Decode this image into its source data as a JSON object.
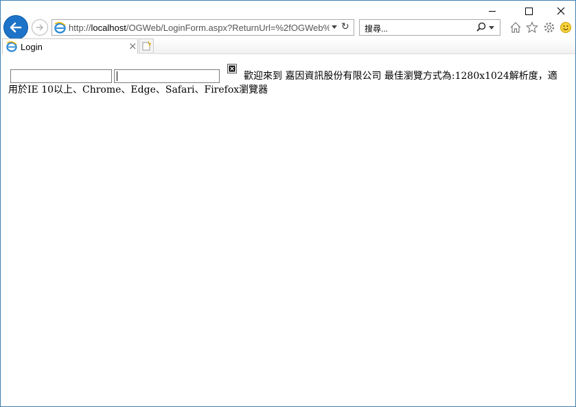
{
  "browser": {
    "address_url_prefix": "http://",
    "address_url_host": "localhost",
    "address_url_path": "/OGWeb/LoginForm.aspx?ReturnUrl=%2fOGWeb%",
    "search_placeholder": "搜尋...",
    "tab_title": "Login",
    "tab_close": "×"
  },
  "page": {
    "message_line": "歡迎來到 嘉因資訊股份有限公司 最佳瀏覽方式為:1280x1024解析度，適用於IE 10以上、Chrome、Edge、Safari、Firefox瀏覽器"
  },
  "colors": {
    "accent": "#1d73c8",
    "window_border": "#3c7fb1"
  }
}
